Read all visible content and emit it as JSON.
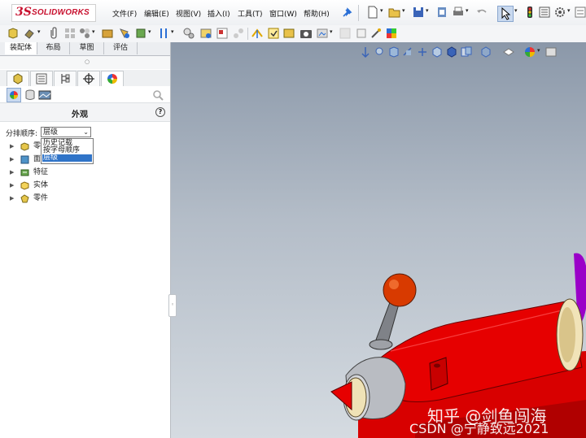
{
  "app": {
    "logo_prefix": "3S",
    "logo_name": "SOLIDWORKS"
  },
  "menus": [
    "文件(F)",
    "编辑(E)",
    "视图(V)",
    "插入(I)",
    "工具(T)",
    "窗口(W)",
    "帮助(H)"
  ],
  "tabs": [
    "装配体",
    "布局",
    "草图",
    "评估"
  ],
  "panel": {
    "title": "外观",
    "help_icon": "?",
    "sort_label": "分排顺序:",
    "sort_selected": "层级",
    "sort_options": [
      "历史记载",
      "按字母顺序",
      "层级"
    ]
  },
  "tree": [
    {
      "label": "零",
      "icon": "parts-icon"
    },
    {
      "label": "面",
      "icon": "face-icon"
    },
    {
      "label": "特征",
      "icon": "feature-icon"
    },
    {
      "label": "实体",
      "icon": "body-icon"
    },
    {
      "label": "零件",
      "icon": "part-icon"
    }
  ],
  "watermarks": {
    "zhihu": "知乎 @剑鱼闯海",
    "csdn": "CSDN @宁静致远2021"
  },
  "colors": {
    "accent": "#c8102e",
    "selection": "#3074c8",
    "model_red": "#e00000"
  }
}
